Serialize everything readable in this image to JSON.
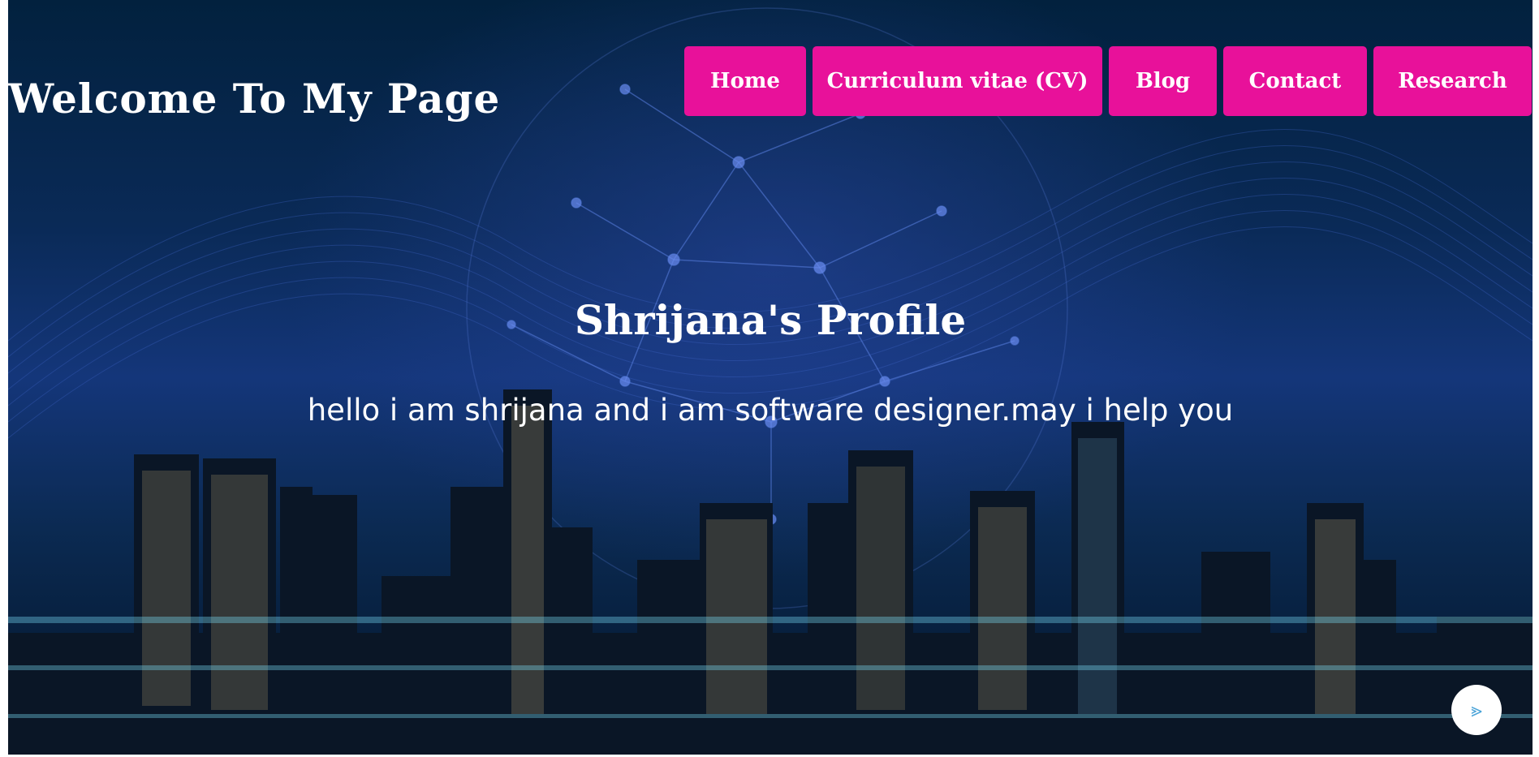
{
  "header": {
    "site_title": "Welcome To My Page"
  },
  "nav": {
    "items": [
      {
        "label": "Home"
      },
      {
        "label": "Curriculum vitae (CV)"
      },
      {
        "label": "Blog"
      },
      {
        "label": "Contact"
      },
      {
        "label": "Research"
      }
    ]
  },
  "hero": {
    "title": "Shrijana's Profile",
    "subtitle": "hello i am shrijana and i am software designer.may i help you"
  },
  "scroll_button": {
    "icon": "chevron-right-icon",
    "glyph": "⪢"
  },
  "colors": {
    "accent": "#e8119a",
    "text": "#ffffff",
    "background": "#0a2a57"
  }
}
